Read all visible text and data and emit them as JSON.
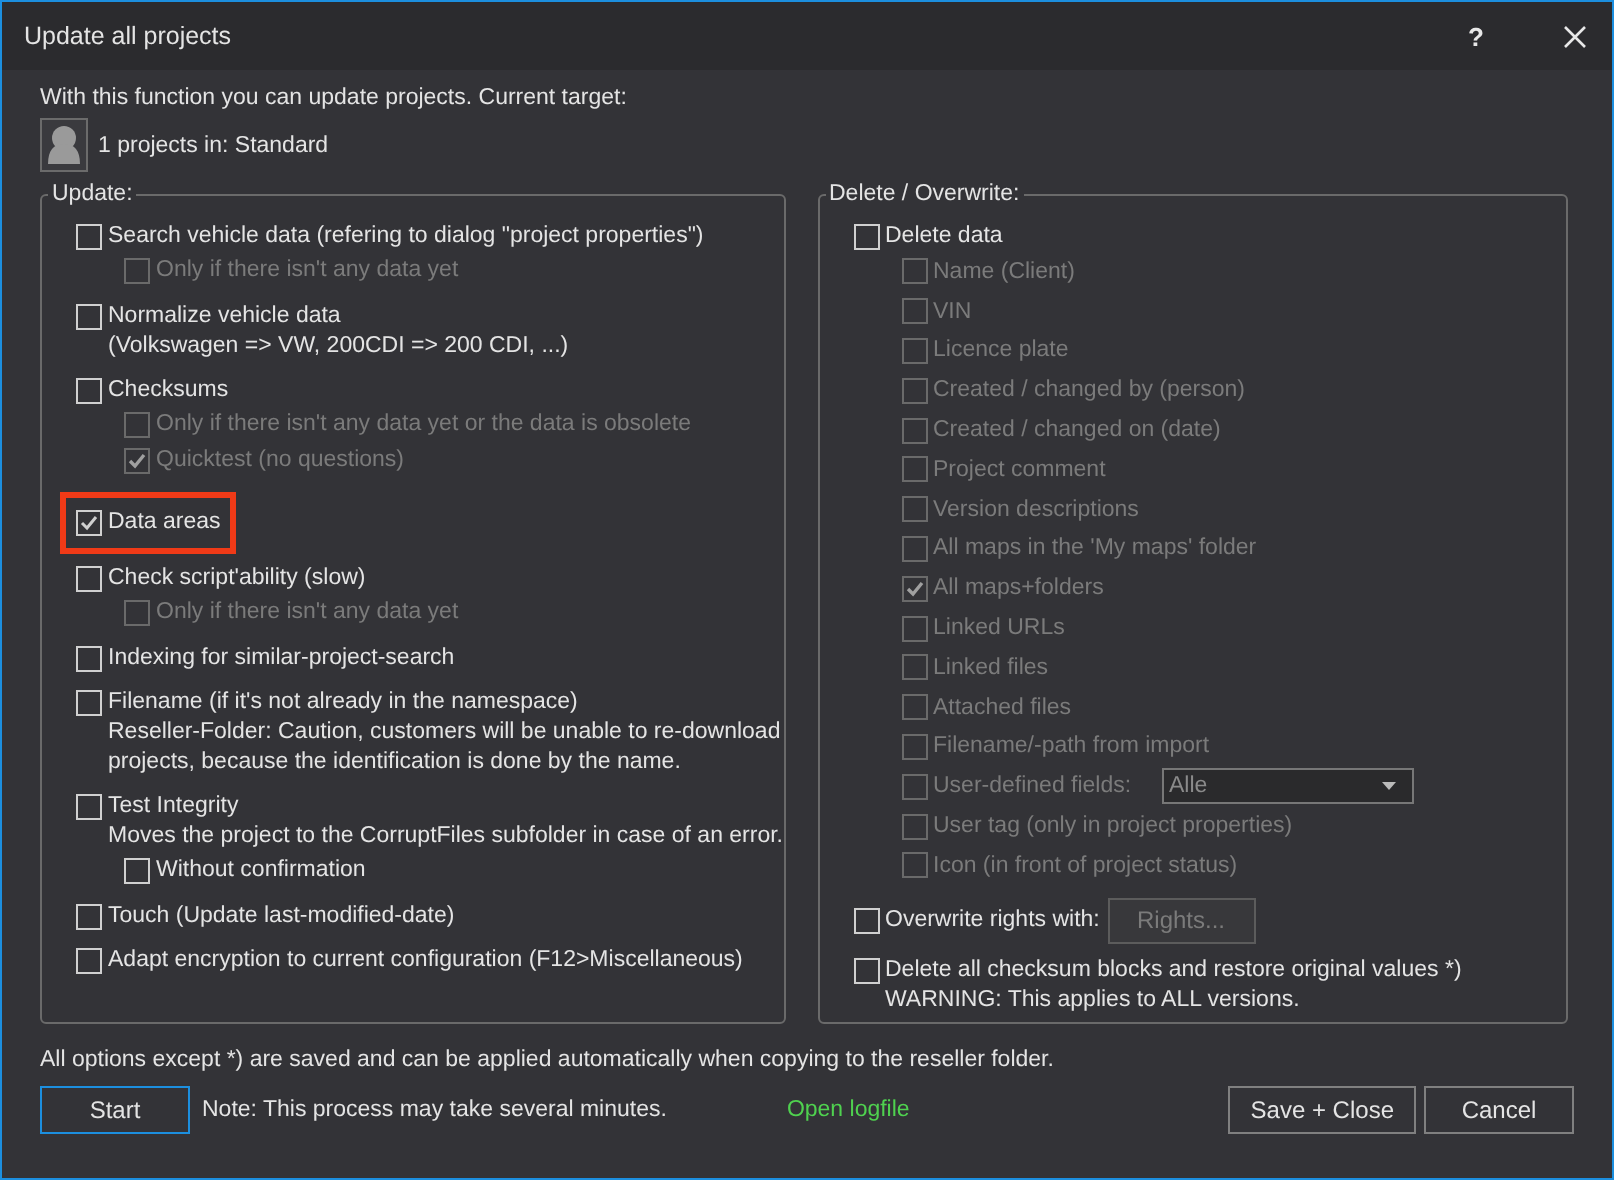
{
  "window": {
    "title": "Update all projects",
    "help": "?"
  },
  "intro": "With this function you can update projects. Current target:",
  "target": "1 projects in: Standard",
  "update_group": {
    "title": "Update:",
    "options": [
      {
        "label": "Search vehicle data (refering to dialog \"project properties\")",
        "checked": false,
        "highlighted": false,
        "children": [
          {
            "label": "Only if there isn't any data yet",
            "checked": false,
            "disabled": true
          }
        ]
      },
      {
        "label": "Normalize vehicle data",
        "description": [
          "(Volkswagen => VW, 200CDI => 200 CDI, ...)"
        ],
        "checked": false,
        "highlighted": false
      },
      {
        "label": "Checksums",
        "checked": false,
        "highlighted": false,
        "children": [
          {
            "label": "Only if there isn't any data yet or the data is obsolete",
            "checked": false,
            "disabled": true
          },
          {
            "label": "Quicktest (no questions)",
            "checked": true,
            "disabled": true
          }
        ]
      },
      {
        "label": "Data areas",
        "checked": true,
        "highlighted": true
      },
      {
        "label": "Check script'ability (slow)",
        "checked": false,
        "highlighted": false,
        "children": [
          {
            "label": "Only if there isn't any data yet",
            "checked": false,
            "disabled": true
          }
        ]
      },
      {
        "label": "Indexing for similar-project-search",
        "checked": false,
        "highlighted": false
      },
      {
        "label": "Filename (if it's not already in the namespace)",
        "description": [
          "Reseller-Folder: Caution, customers will be unable to re-download",
          "projects, because the identification is done by the name."
        ],
        "checked": false,
        "highlighted": false
      },
      {
        "label": "Test Integrity",
        "description": [
          "Moves the project to the CorruptFiles subfolder in case of an error."
        ],
        "checked": false,
        "highlighted": false,
        "children": [
          {
            "label": "Without confirmation",
            "checked": false,
            "disabled": false
          }
        ]
      },
      {
        "label": "Touch (Update last-modified-date)",
        "checked": false,
        "highlighted": false
      },
      {
        "label": "Adapt encryption to current configuration (F12>Miscellaneous)",
        "checked": false,
        "highlighted": false
      }
    ]
  },
  "delete_group": {
    "title": "Delete / Overwrite:",
    "options": [
      {
        "kind": "checkbox",
        "label": "Delete data",
        "checked": false,
        "children": [
          {
            "kind": "checkbox",
            "label": "Name (Client)",
            "checked": false,
            "disabled": true
          },
          {
            "kind": "checkbox",
            "label": "VIN",
            "checked": false,
            "disabled": true
          },
          {
            "kind": "checkbox",
            "label": "Licence plate",
            "checked": false,
            "disabled": true
          },
          {
            "kind": "checkbox",
            "label": "Created / changed by (person)",
            "checked": false,
            "disabled": true
          },
          {
            "kind": "checkbox",
            "label": "Created / changed on (date)",
            "checked": false,
            "disabled": true
          },
          {
            "kind": "checkbox",
            "label": "Project comment",
            "checked": false,
            "disabled": true
          },
          {
            "kind": "checkbox",
            "label": "Version descriptions",
            "checked": false,
            "disabled": true
          },
          {
            "kind": "checkbox",
            "label": "All maps in the 'My maps' folder",
            "checked": false,
            "disabled": true
          },
          {
            "kind": "checkbox",
            "label": "All maps+folders",
            "checked": true,
            "disabled": true
          },
          {
            "kind": "checkbox",
            "label": "Linked URLs",
            "checked": false,
            "disabled": true
          },
          {
            "kind": "checkbox",
            "label": "Linked files",
            "checked": false,
            "disabled": true
          },
          {
            "kind": "checkbox",
            "label": "Attached files",
            "checked": false,
            "disabled": true
          },
          {
            "kind": "checkbox",
            "label": "Filename/-path from import",
            "checked": false,
            "disabled": true
          },
          {
            "kind": "dropdown",
            "label": "User-defined fields:",
            "checked": false,
            "disabled": true,
            "value": "Alle"
          },
          {
            "kind": "checkbox",
            "label": "User tag (only in project properties)",
            "checked": false,
            "disabled": true
          },
          {
            "kind": "checkbox",
            "label": "Icon (in front of project status)",
            "checked": false,
            "disabled": true
          }
        ]
      },
      {
        "kind": "button",
        "label": "Overwrite rights with:",
        "checked": false,
        "button": "Rights...",
        "button_disabled": true
      },
      {
        "kind": "checkbox",
        "label": "Delete all checksum blocks and restore original values *)",
        "description": [
          "WARNING: This applies to ALL versions."
        ],
        "checked": false
      }
    ]
  },
  "footer_note": "All options except *) are saved and can be applied automatically when copying to the reseller folder.",
  "start_button": {
    "label": "Start",
    "focused": true
  },
  "process_note": "Note: This process may take several minutes.",
  "logfile_link": "Open logfile",
  "buttons": [
    {
      "label": "Save + Close",
      "focused": false
    },
    {
      "label": "Cancel",
      "focused": false
    }
  ]
}
